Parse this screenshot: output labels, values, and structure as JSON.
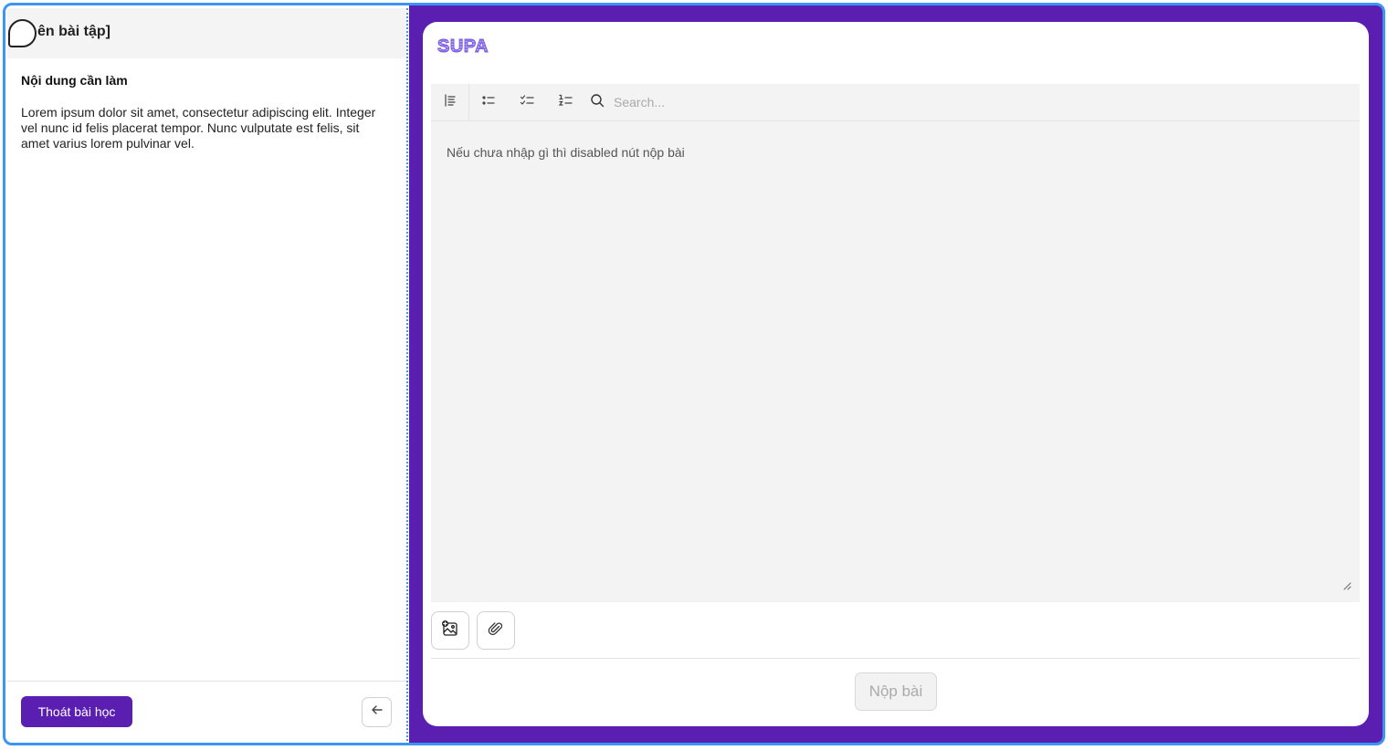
{
  "left_panel": {
    "lesson_title": "ên bài tập]",
    "content_heading": "Nội dung cần làm",
    "content_body": "Lorem ipsum dolor sit amet, consectetur adipiscing elit. Integer vel nunc id felis placerat tempor. Nunc vulputate est felis, sit amet varius lorem pulvinar vel.",
    "exit_label": "Thoát bài học",
    "back_icon": "arrow-left-icon"
  },
  "right_panel": {
    "logo_text": "SUPA",
    "toolbar": {
      "items": [
        {
          "icon": "align-left-icon"
        },
        {
          "icon": "bullet-list-icon"
        },
        {
          "icon": "checklist-icon"
        },
        {
          "icon": "numbered-list-icon"
        }
      ],
      "search_placeholder": "Search..."
    },
    "editor_text": "Nếu chưa nhập gì thì disabled nút nộp bài",
    "attach_buttons": [
      {
        "icon": "add-image-icon"
      },
      {
        "icon": "paperclip-icon"
      }
    ],
    "submit_label": "Nộp bài"
  },
  "colors": {
    "accent": "#5a1fb0",
    "frame_border": "#3b95f5",
    "editor_bg": "#f3f3f3"
  }
}
